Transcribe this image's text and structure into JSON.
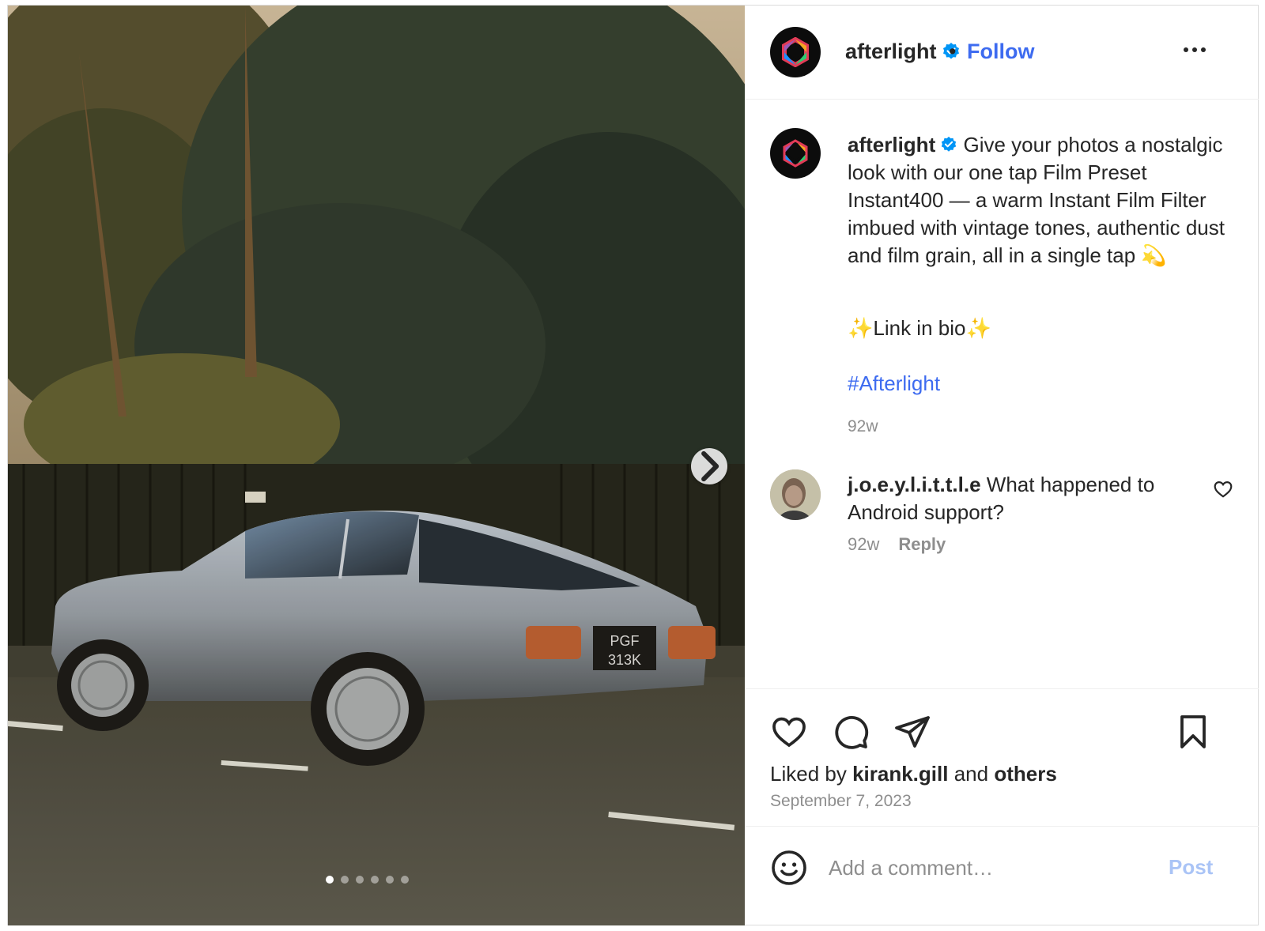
{
  "post": {
    "photo_alt": "car-photo",
    "carousel": {
      "total": 6,
      "current": 1
    },
    "plate_line1": "PGF",
    "plate_line2": "313K"
  },
  "header": {
    "username": "afterlight",
    "separator": "•",
    "follow_label": "Follow",
    "verified_color": "#0095f6"
  },
  "caption": {
    "username": "afterlight",
    "text": "Give your photos a nostalgic look with our one tap Film Preset Instant400 — a warm Instant Film Filter imbued with vintage tones, authentic dust and film grain, all in a single tap 💫",
    "link_in_bio": "✨Link in bio✨",
    "hashtag": "#Afterlight",
    "time": "92w"
  },
  "comment": {
    "username": "j.o.e.y.l.i.t.t.l.e",
    "text": "What happened to Android support?",
    "time": "92w",
    "reply_label": "Reply"
  },
  "actions": {
    "liked_by_prefix": "Liked by",
    "liked_by_user": "kirank.gill",
    "liked_by_and": "and",
    "liked_by_others": "others",
    "date": "September 7, 2023"
  },
  "add_comment": {
    "placeholder": "Add a comment…",
    "post_label": "Post"
  },
  "colors": {
    "accent": "#0095f6",
    "follow_text": "#3d6bf0",
    "post_disabled": "#aac4f6",
    "muted": "#8e8e8e"
  }
}
